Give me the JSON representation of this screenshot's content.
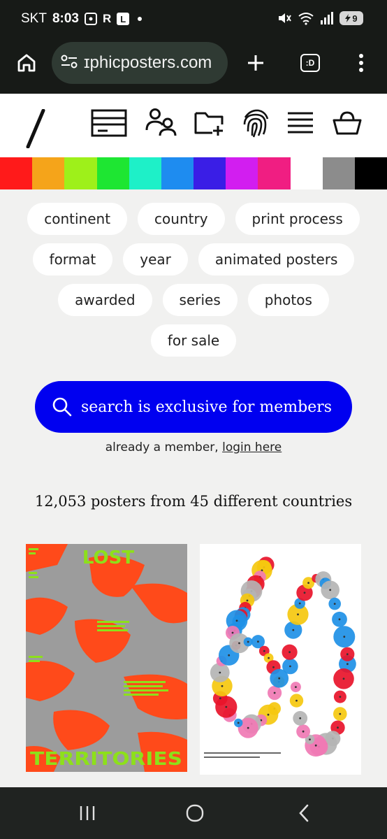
{
  "status_bar": {
    "carrier": "SKT",
    "time": "8:03",
    "icons": [
      "screenshot-icon",
      "r-icon",
      "l-icon",
      "dot-icon",
      "mute-icon",
      "wifi-6e-icon",
      "signal-icon"
    ],
    "r_letter": "R",
    "l_letter": "L",
    "battery_level": "9"
  },
  "browser": {
    "url": "ɪphicposters.com",
    "tabs_label": ":D"
  },
  "colors": [
    "#ff1a1a",
    "#f5a41a",
    "#9ef01a",
    "#1ee632",
    "#1ef0c8",
    "#1e8cf0",
    "#3a1ee6",
    "#d21ef0",
    "#f01e82",
    "#ffffff",
    "#8c8c8c",
    "#000000"
  ],
  "filters": {
    "row1": [
      "continent",
      "country",
      "print process"
    ],
    "row2": [
      "format",
      "year",
      "animated posters"
    ],
    "row3": [
      "awarded",
      "series",
      "photos"
    ],
    "row4": [
      "for sale"
    ]
  },
  "search": {
    "label": "search is exclusive for members",
    "member_prefix": "already a member,",
    "login_link": "login here"
  },
  "stats": "12,053 posters from 45 different countries",
  "posters": {
    "poster1_title_top": "LOST",
    "poster1_title_bottom": "TERRITORIES",
    "poster2_number": "60"
  }
}
